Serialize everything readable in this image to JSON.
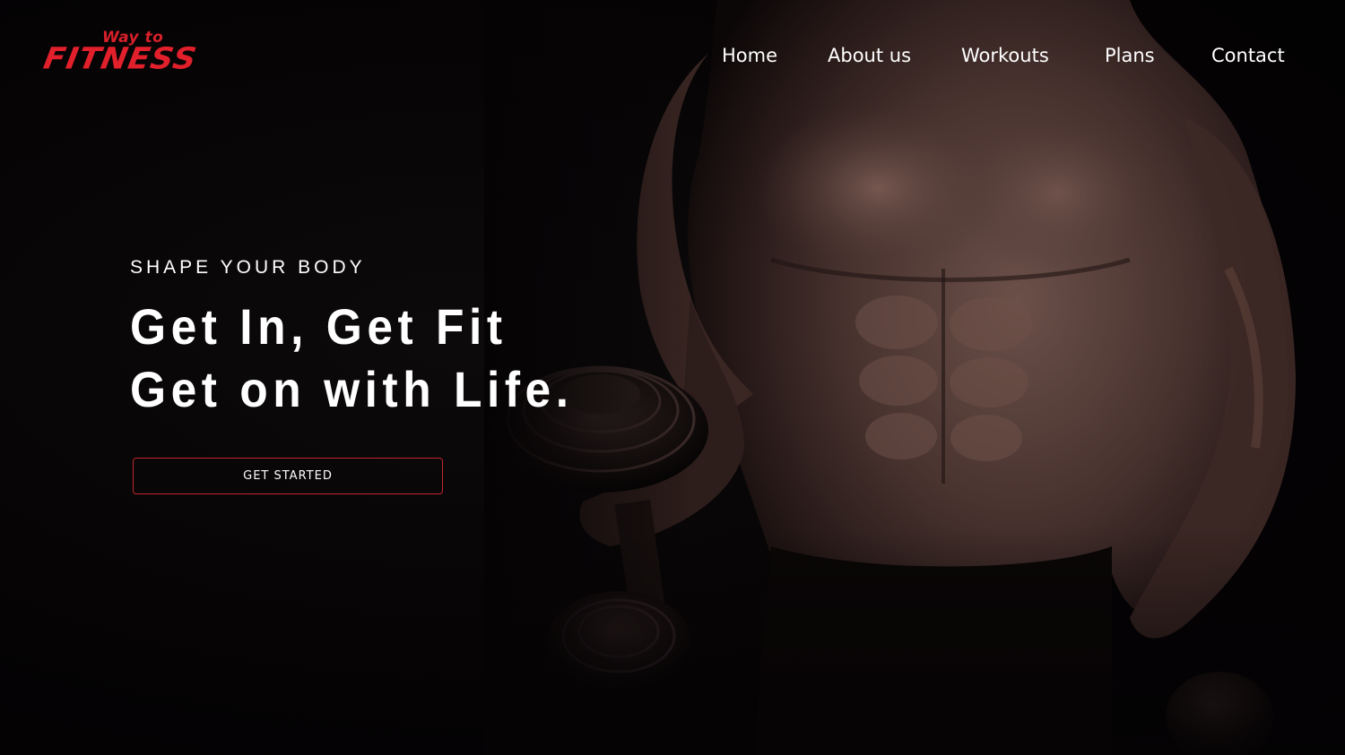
{
  "brand": {
    "tagline": "Way to",
    "name": "FITNESS",
    "color": "#e1202c"
  },
  "nav": {
    "items": [
      {
        "label": "Home"
      },
      {
        "label": "About us"
      },
      {
        "label": "Workouts"
      },
      {
        "label": "Plans"
      },
      {
        "label": "Contact"
      }
    ]
  },
  "hero": {
    "eyebrow": "SHAPE YOUR BODY",
    "headline_line1": "Get In, Get Fit",
    "headline_line2": "Get on with Life.",
    "cta_label": "GET STARTED",
    "cta_border_color": "#c0262f",
    "image_subject": "shirtless athlete holding dumbbells"
  }
}
